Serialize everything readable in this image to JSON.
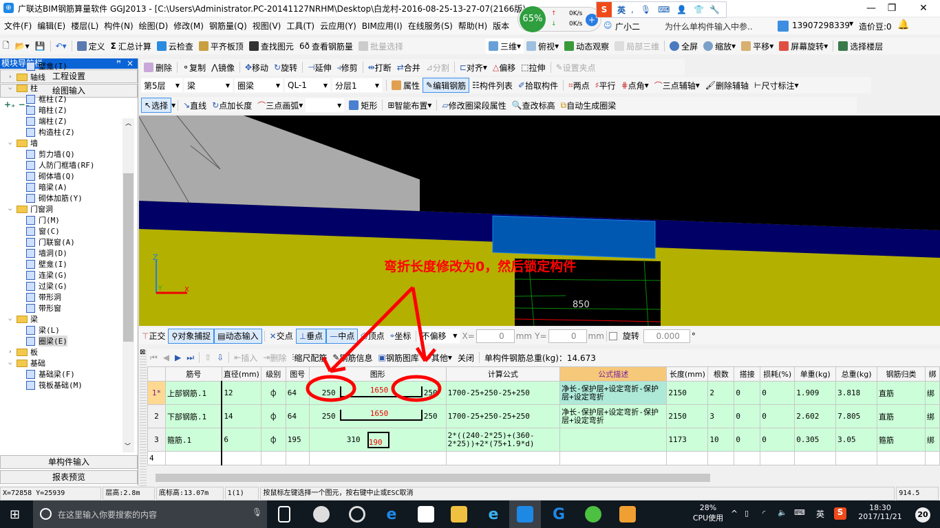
{
  "window": {
    "title": "广联达BIM钢筋算量软件 GGJ2013 - [C:\\Users\\Administrator.PC-20141127NRHM\\Desktop\\白龙村-2016-08-25-13-27-07(2166版)",
    "minimize": "—",
    "restore": "❐",
    "close": "✕"
  },
  "overlay": {
    "cpu_percent": "65%",
    "upload": "0K/s",
    "download": "0K/s",
    "ime_lang": "英"
  },
  "menu": [
    "文件(F)",
    "编辑(E)",
    "楼层(L)",
    "构件(N)",
    "绘图(D)",
    "修改(M)",
    "钢筋量(Q)",
    "视图(V)",
    "工具(T)",
    "云应用(Y)",
    "BIM应用(I)",
    "在线服务(S)",
    "帮助(H)",
    "版本"
  ],
  "menu_right": {
    "assistant": "广小二",
    "question": "为什么单构件输入中参..",
    "account": "13907298339",
    "beans": "造价豆:0"
  },
  "toolbar1": {
    "left": [
      "定义",
      "汇总计算",
      "云检查",
      "平齐板顶",
      "查找图元",
      "查看钢筋量",
      "批量选择"
    ],
    "right": [
      "三维",
      "俯视",
      "动态观察",
      "局部三维",
      "全屏",
      "缩放",
      "平移",
      "屏幕旋转",
      "选择楼层"
    ]
  },
  "toolbar2": [
    "删除",
    "复制",
    "镜像",
    "移动",
    "旋转",
    "延伸",
    "修剪",
    "打断",
    "合并",
    "分割",
    "对齐",
    "偏移",
    "拉伸",
    "设置夹点"
  ],
  "toolbar3": {
    "floor": "第5层",
    "type": "梁",
    "subtype": "圈梁",
    "name": "QL-1",
    "layer": "分层1",
    "buttons": [
      "属性",
      "编辑钢筋",
      "构件列表",
      "拾取构件",
      "两点",
      "平行",
      "点角",
      "三点辅轴",
      "删除辅轴",
      "尺寸标注"
    ]
  },
  "toolbar4": [
    "选择",
    "直线",
    "点加长度",
    "三点画弧",
    "矩形",
    "智能布置",
    "修改圈梁段属性",
    "查改标高",
    "自动生成圈梁"
  ],
  "nav": {
    "title": "模块导航栏",
    "pin": "ꟸ",
    "close": "×",
    "project_settings": "工程设置",
    "drawing_input": "绘图输入",
    "single_input": "单构件输入",
    "report": "报表预览",
    "tree": [
      {
        "label": "壁龛(I)",
        "level": 2
      },
      {
        "label": "轴线",
        "level": 1,
        "folder": true,
        "expanded": false
      },
      {
        "label": "柱",
        "level": 1,
        "folder": true,
        "expanded": true
      },
      {
        "label": "框柱(Z)",
        "level": 2
      },
      {
        "label": "暗柱(Z)",
        "level": 2
      },
      {
        "label": "端柱(Z)",
        "level": 2
      },
      {
        "label": "构造柱(Z)",
        "level": 2
      },
      {
        "label": "墙",
        "level": 1,
        "folder": true,
        "expanded": true
      },
      {
        "label": "剪力墙(Q)",
        "level": 2
      },
      {
        "label": "人防门框墙(RF)",
        "level": 2
      },
      {
        "label": "砌体墙(Q)",
        "level": 2
      },
      {
        "label": "暗梁(A)",
        "level": 2
      },
      {
        "label": "砌体加筋(Y)",
        "level": 2
      },
      {
        "label": "门窗洞",
        "level": 1,
        "folder": true,
        "expanded": true
      },
      {
        "label": "门(M)",
        "level": 2
      },
      {
        "label": "窗(C)",
        "level": 2
      },
      {
        "label": "门联窗(A)",
        "level": 2
      },
      {
        "label": "墙洞(D)",
        "level": 2
      },
      {
        "label": "壁龛(I)",
        "level": 2
      },
      {
        "label": "连梁(G)",
        "level": 2
      },
      {
        "label": "过梁(G)",
        "level": 2
      },
      {
        "label": "带形洞",
        "level": 2
      },
      {
        "label": "带形窗",
        "level": 2
      },
      {
        "label": "梁",
        "level": 1,
        "folder": true,
        "expanded": true
      },
      {
        "label": "梁(L)",
        "level": 2
      },
      {
        "label": "圈梁(E)",
        "level": 2,
        "selected": true
      },
      {
        "label": "板",
        "level": 1,
        "folder": true,
        "expanded": false
      },
      {
        "label": "基础",
        "level": 1,
        "folder": true,
        "expanded": true
      },
      {
        "label": "基础梁(F)",
        "level": 2
      },
      {
        "label": "筏板基础(M)",
        "level": 2
      }
    ]
  },
  "viewport": {
    "annotation": "弯折长度修改为0，然后锁定构件",
    "dimension": "850",
    "axis_x": "X",
    "axis_y": "Y",
    "axis_z": "Z"
  },
  "snap": {
    "buttons": [
      "正交",
      "对象捕捉",
      "动态输入",
      "交点",
      "垂点",
      "中点",
      "顶点",
      "坐标"
    ],
    "offset": "不偏移",
    "x_label": "X=",
    "x_value": "0",
    "y_label": "Y=",
    "y_value": "0",
    "unit": "mm",
    "rotate_label": "旋转",
    "rotate_value": "0.000",
    "degree": "°"
  },
  "rebar_toolbar": {
    "buttons": [
      "插入",
      "删除",
      "缩尺配筋",
      "钢筋信息",
      "钢筋图库",
      "其他",
      "关闭"
    ],
    "total_label": "单构件钢筋总重(kg)：14.673"
  },
  "table": {
    "headers": [
      "",
      "筋号",
      "直径(mm)",
      "级别",
      "图号",
      "图形",
      "计算公式",
      "公式描述",
      "长度(mm)",
      "根数",
      "搭接",
      "损耗(%)",
      "单重(kg)",
      "总重(kg)",
      "钢筋归类",
      "绑"
    ],
    "rows": [
      {
        "no": "1*",
        "name": "上部钢筋.1",
        "dia": "12",
        "grade": "⏀",
        "fig": "64",
        "shape": {
          "left": "250",
          "mid": "1650",
          "right": "250"
        },
        "formula": "1700-25+250-25+250",
        "desc": "净长-保护层+设定弯折-保护层+设定弯折",
        "len": "2150",
        "count": "2",
        "lap": "0",
        "loss": "0",
        "unit_w": "1.909",
        "total_w": "3.818",
        "cat": "直筋",
        "extra": "绑"
      },
      {
        "no": "2",
        "name": "下部钢筋.1",
        "dia": "14",
        "grade": "⏀",
        "fig": "64",
        "shape": {
          "left": "250",
          "mid": "1650",
          "right": "250"
        },
        "formula": "1700-25+250-25+250",
        "desc": "净长-保护层+设定弯折-保护层+设定弯折",
        "len": "2150",
        "count": "3",
        "lap": "0",
        "loss": "0",
        "unit_w": "2.602",
        "total_w": "7.805",
        "cat": "直筋",
        "extra": "绑"
      },
      {
        "no": "3",
        "name": "箍筋.1",
        "dia": "6",
        "grade": "⏀",
        "fig": "195",
        "shape": {
          "left": "310",
          "mid": "190",
          "right": ""
        },
        "formula": "2*((240-2*25)+(360-2*25))+2*(75+1.9*d)",
        "desc": "",
        "len": "1173",
        "count": "10",
        "lap": "0",
        "loss": "0",
        "unit_w": "0.305",
        "total_w": "3.05",
        "cat": "箍筋",
        "extra": "绑"
      },
      {
        "no": "4"
      }
    ]
  },
  "status": {
    "coords": "X=72858 Y=25939",
    "floor_height": "层高:2.8m",
    "base_elev": "底标高:13.07m",
    "count": "1(1)",
    "hint": "按鼠标左键选择一个图元，按右键中止或ESC取消",
    "fps": "914.5 FPS"
  },
  "taskbar": {
    "search": "在这里输入你要搜索的内容",
    "cpu": "28%",
    "cpu_label": "CPU使用",
    "ime": "英",
    "time": "18:30",
    "date": "2017/11/21",
    "notifications": "20"
  },
  "colors": {
    "accent": "#0a64d6",
    "row_bg": "#ccffd9",
    "annotation": "#ff0000",
    "beam": "#0058b0"
  }
}
